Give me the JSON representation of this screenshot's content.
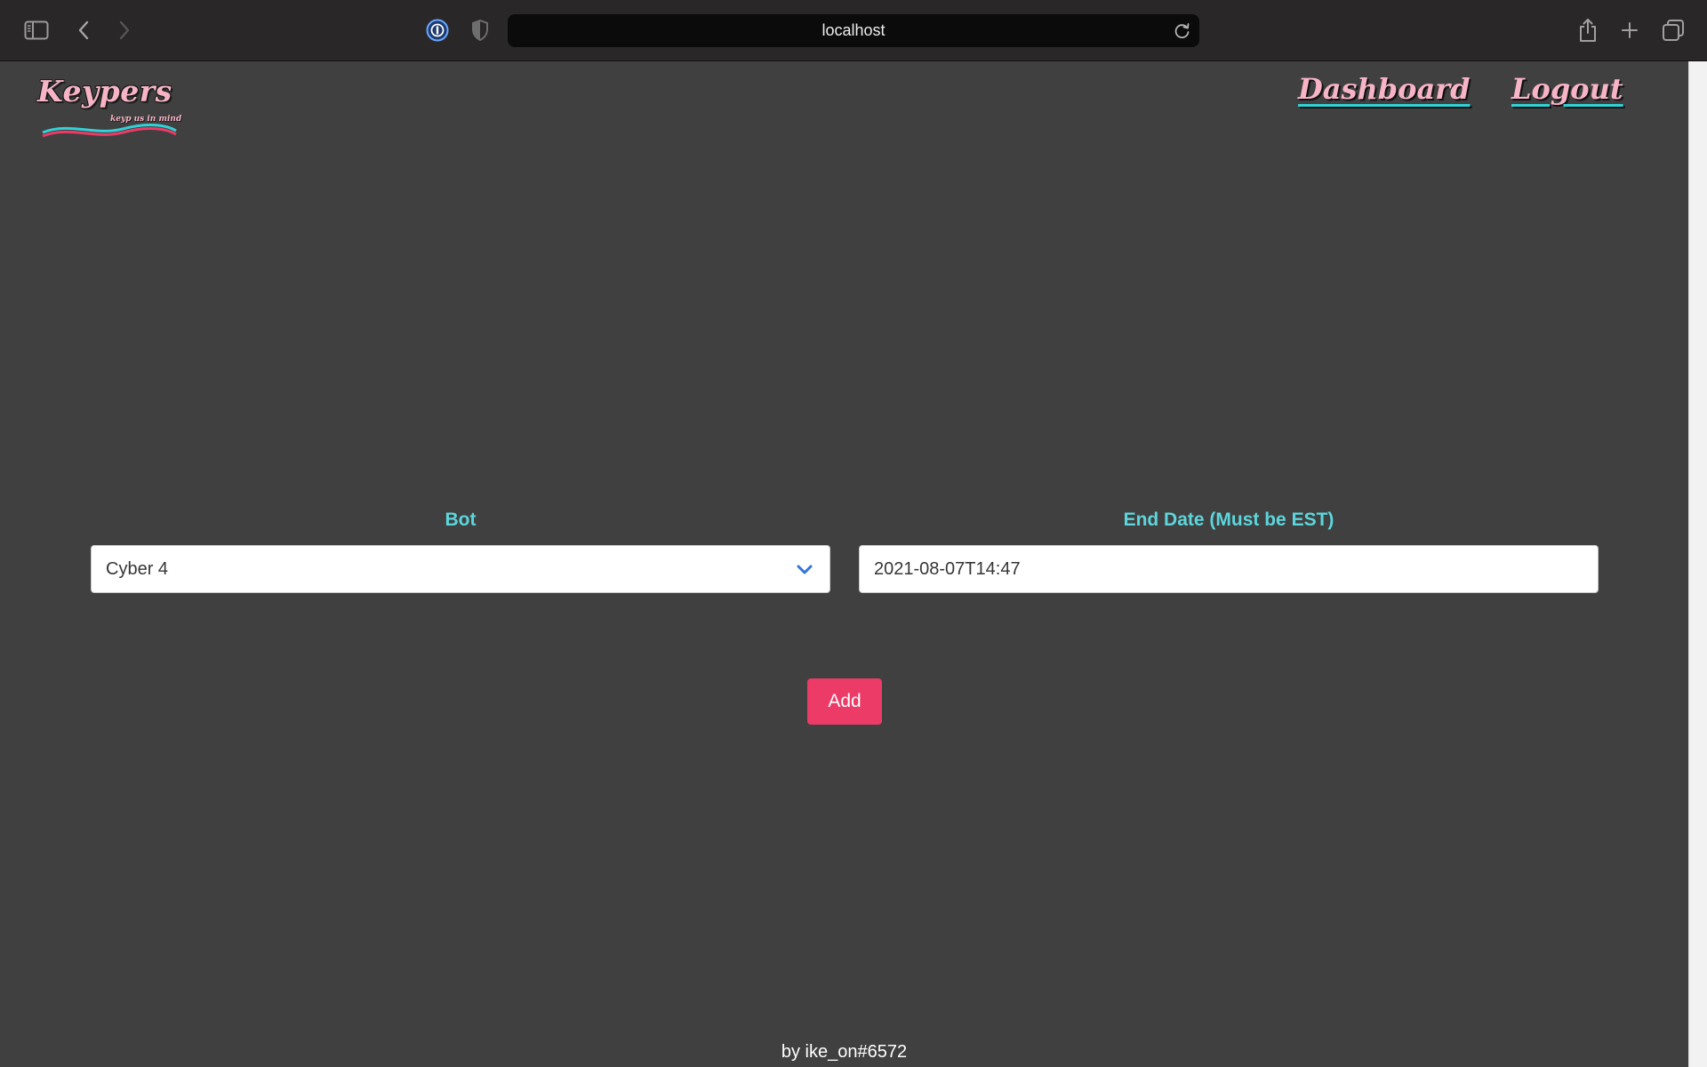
{
  "browser": {
    "url": "localhost",
    "icons": {
      "sidebar": "sidebar-icon",
      "back": "back-chevron-icon",
      "forward": "forward-chevron-icon",
      "password_manager": "password-manager-icon",
      "privacy": "shield-icon",
      "reload": "reload-icon",
      "share": "share-icon",
      "new_tab": "plus-icon",
      "tabs": "tab-overview-icon"
    }
  },
  "header": {
    "logo_text": "Keypers",
    "logo_tagline": "keyp us in mind",
    "nav": [
      {
        "label": "Dashboard"
      },
      {
        "label": "Logout"
      }
    ]
  },
  "form": {
    "bot_label": "Bot",
    "bot_value": "Cyber 4",
    "end_date_label": "End Date (Must be EST)",
    "end_date_value": "2021-08-07T14:47",
    "add_label": "Add"
  },
  "footer": {
    "credit": "by ike_on#6572"
  },
  "colors": {
    "page_background": "#404040",
    "accent_pink": "#f7b4c6",
    "accent_cyan": "#5cd6dc",
    "button_red": "#ec3b67",
    "chrome_background": "#2a2729"
  }
}
